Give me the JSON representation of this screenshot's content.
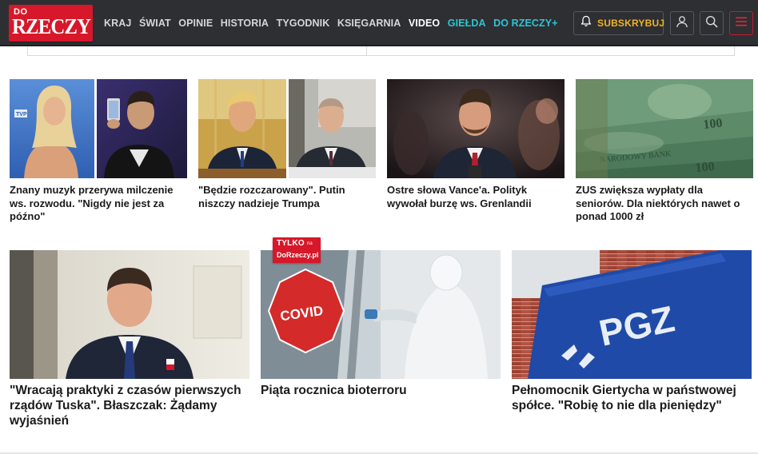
{
  "brand": {
    "logo_top": "DO",
    "logo_main": "RZECZY",
    "color": "#d6182a"
  },
  "nav": {
    "items": [
      {
        "label": "KRAJ",
        "style": "normal"
      },
      {
        "label": "ŚWIAT",
        "style": "normal"
      },
      {
        "label": "OPINIE",
        "style": "normal"
      },
      {
        "label": "HISTORIA",
        "style": "normal"
      },
      {
        "label": "TYGODNIK",
        "style": "normal"
      },
      {
        "label": "KSIĘGARNIA",
        "style": "normal"
      },
      {
        "label": "VIDEO",
        "style": "white"
      },
      {
        "label": "GIEŁDA",
        "style": "teal"
      },
      {
        "label": "DO RZECZY+",
        "style": "teal"
      }
    ]
  },
  "header_actions": {
    "subscribe_label": "SUBSKRYBUJ",
    "icons": [
      "bell-icon",
      "user-icon",
      "search-icon",
      "hamburger-menu-icon"
    ],
    "accent": "#f0b323"
  },
  "articles_row1": [
    {
      "title": "Znany muzyk przerywa milczenie ws. rozwodu. \"Nigdy nie jest za późno\""
    },
    {
      "title": "\"Będzie rozczarowany\". Putin niszczy nadzieje Trumpa"
    },
    {
      "title": "Ostre słowa Vance'a. Polityk wywołał burzę ws. Grenlandii"
    },
    {
      "title": "ZUS zwiększa wypłaty dla seniorów. Dla niektórych nawet o ponad 1000 zł"
    }
  ],
  "articles_row2": [
    {
      "title": "\"Wracają praktyki z czasów pierwszych rządów Tuska\". Błaszczak: Żądamy wyjaśnień"
    },
    {
      "title": "Piąta rocznica bioterroru",
      "badge_line1": "TYLKO",
      "badge_line1_small": "na",
      "badge_line2": "DoRzeczy.pl",
      "image_sign_text": "COVID"
    },
    {
      "title": "Pełnomocnik Giertycha w państwowej spółce. \"Robię to nie dla pieniędzy\"",
      "image_sign_text": "PGZ"
    }
  ],
  "image_texts": {
    "tvp_mark": "TVP"
  }
}
